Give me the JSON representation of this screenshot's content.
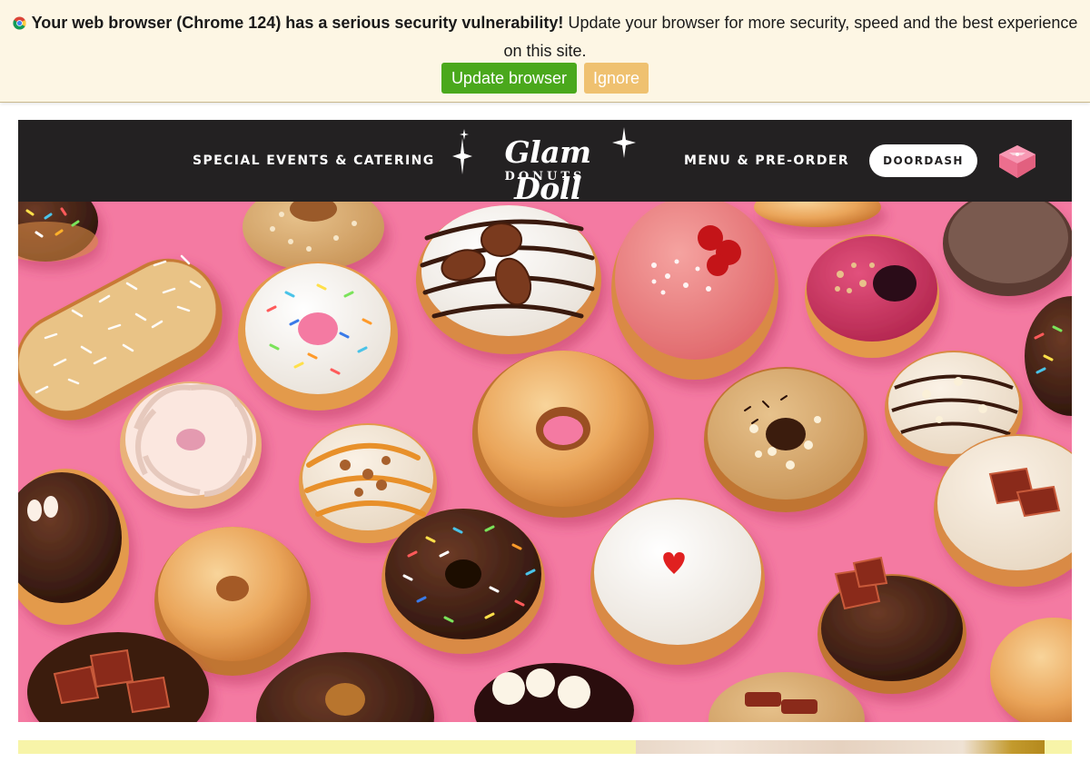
{
  "browser_warning": {
    "bold_text": "Your web browser (Chrome 124) has a serious security vulnerability!",
    "text": " Update your browser for more security, speed and the best experience on this site.",
    "update_label": "Update browser",
    "ignore_label": "Ignore",
    "colors": {
      "background": "#fdf6e4",
      "update": "#4aa81c",
      "ignore": "#efc170"
    }
  },
  "header": {
    "nav_left": "SPECIAL EVENTS & CATERING",
    "logo_main": "Glam Doll",
    "logo_sub": "DONUTS",
    "nav_right": "MENU & PRE-ORDER",
    "doordash_label": "DOORDASH",
    "box_icon": "donut-box-icon",
    "colors": {
      "background": "#232122",
      "box": "#f37b9c"
    }
  },
  "hero": {
    "image": "assorted-donuts-on-pink-photo",
    "background": "#f47aa2"
  },
  "next_section": {
    "background": "#f7f4a8"
  }
}
